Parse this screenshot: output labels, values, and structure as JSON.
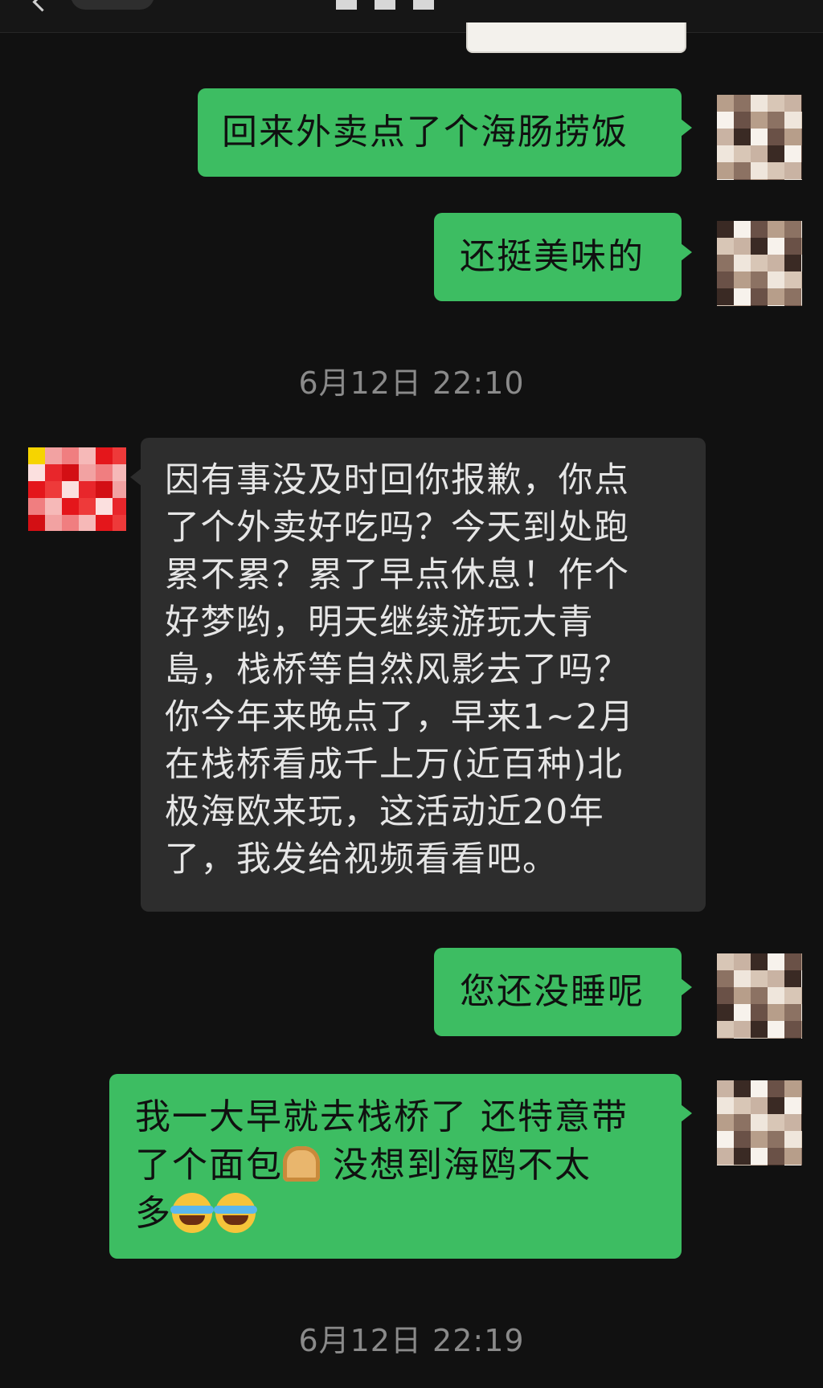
{
  "header": {},
  "messages": [
    {
      "id": "m1",
      "direction": "out",
      "text": "回来外卖点了个海肠捞饭"
    },
    {
      "id": "m2",
      "direction": "out",
      "text": "还挺美味的"
    },
    {
      "id": "m3",
      "direction": "in",
      "text": "因有事没及时回你报歉，你点\n了个外卖好吃吗？今天到处跑\n累不累？累了早点休息！作个\n好梦哟，明天继续游玩大青\n島，栈桥等自然风影去了吗？\n你今年来晚点了，早来1~2月\n在栈桥看成千上万(近百种)北\n极海欧来玩，这活动近20年\n了，我发给视频看看吧。"
    },
    {
      "id": "m4",
      "direction": "out",
      "text": "您还没睡呢"
    },
    {
      "id": "m5",
      "direction": "out",
      "text_line1": "我一大早就去栈桥了 还特意带",
      "text_line2a": "了个面包",
      "text_line2b": " 没想到海鸥不太",
      "text_line3": "多",
      "emojis": [
        "bread-emoji",
        "loudly-crying-face-emoji",
        "loudly-crying-face-emoji"
      ]
    }
  ],
  "timestamps": [
    "6月12日 22:10",
    "6月12日 22:19"
  ],
  "colors": {
    "background": "#111111",
    "outgoing_bubble": "#3dbd62",
    "incoming_bubble": "#2d2d2d",
    "timestamp": "#8a8a8a"
  }
}
